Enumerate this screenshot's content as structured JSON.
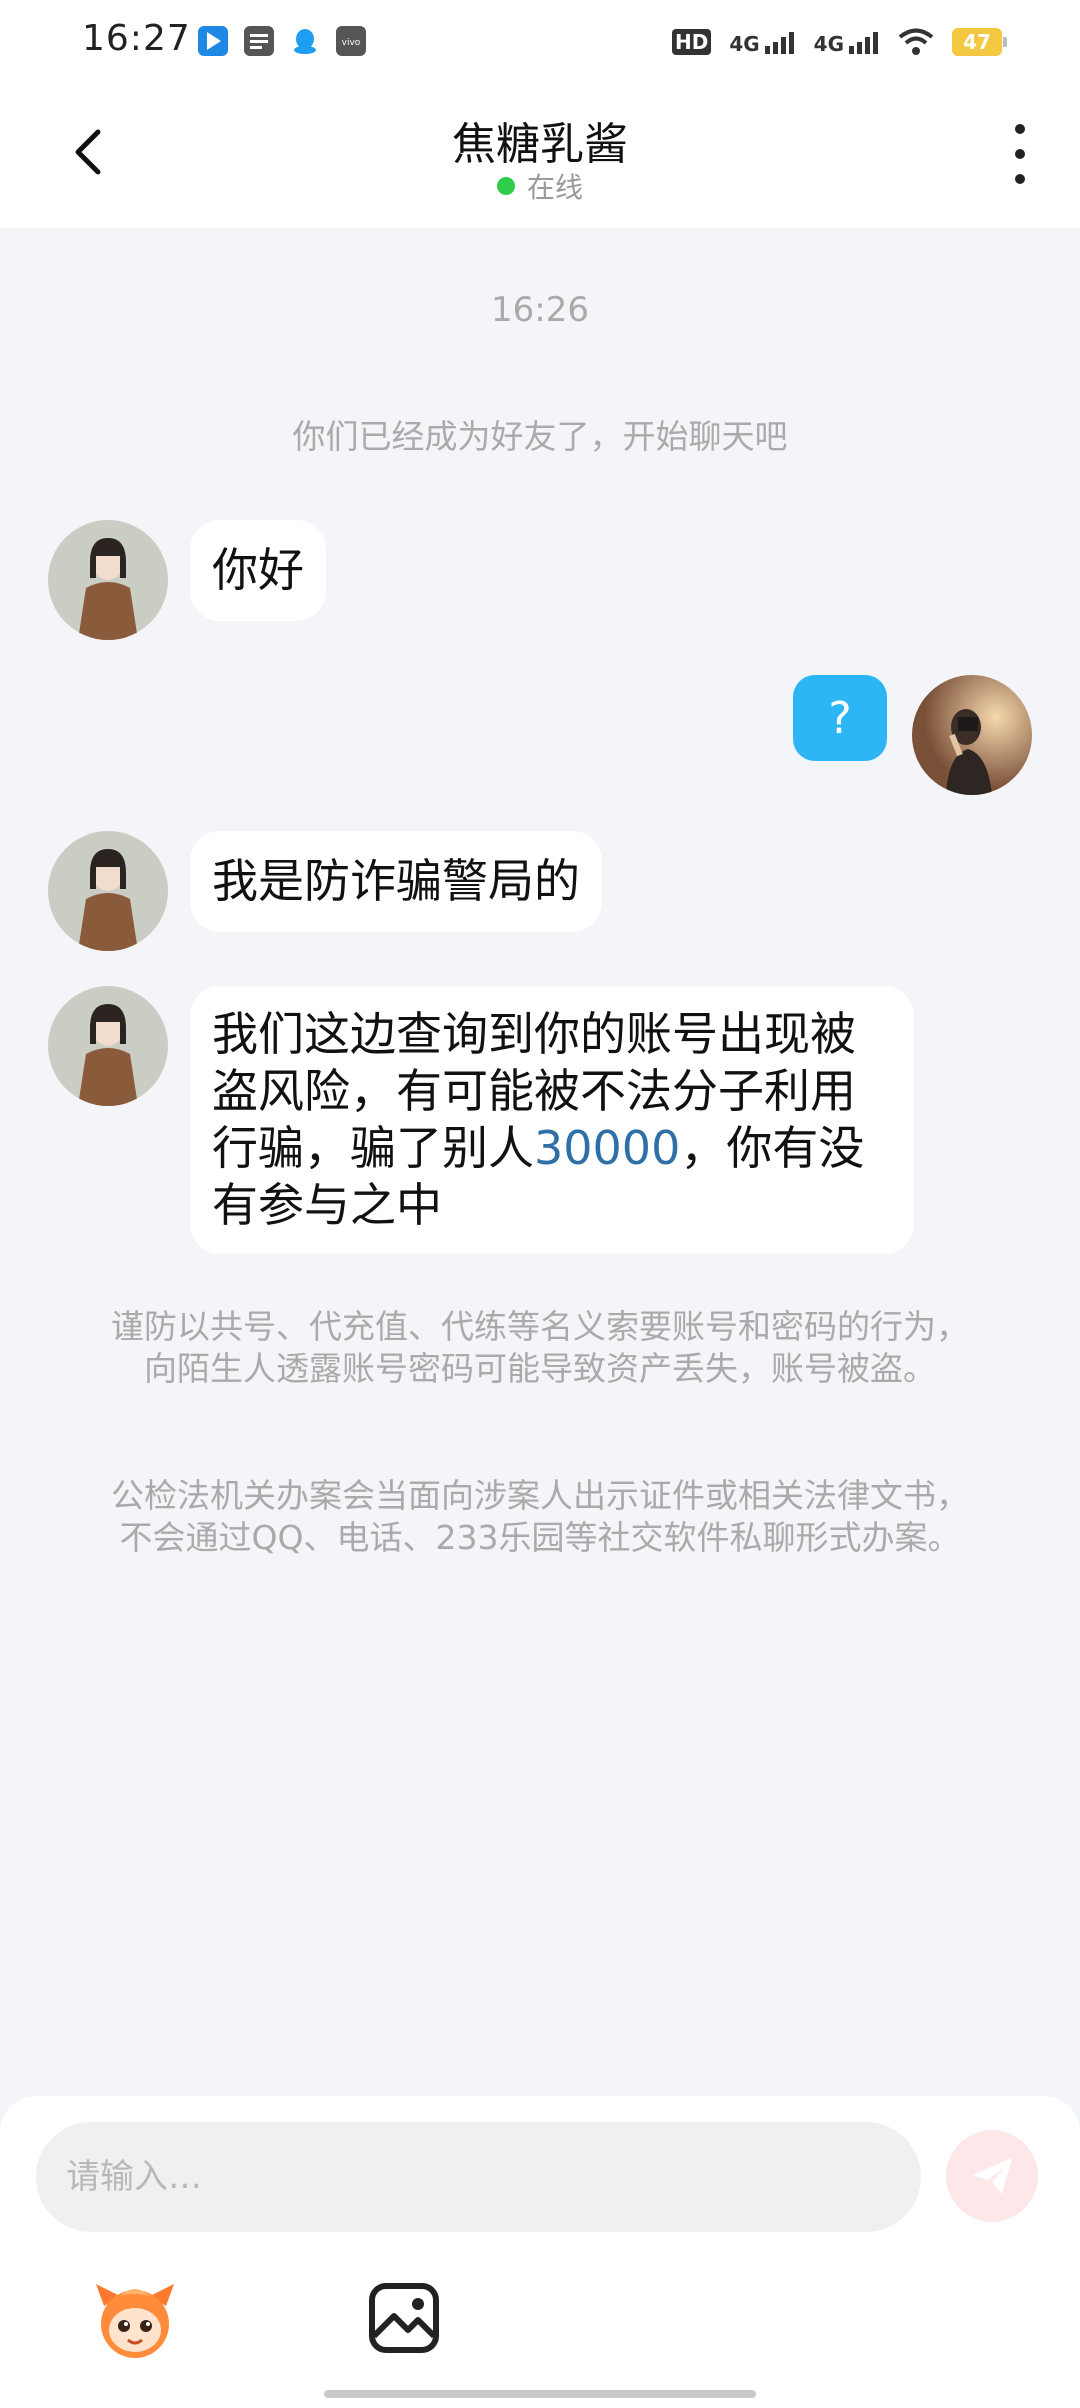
{
  "status_bar": {
    "time": "16:27",
    "hd_label": "HD",
    "sim1_network": "4G",
    "sim2_network": "4G",
    "battery_level": "47",
    "icons": [
      "app-blue-icon",
      "calendar-icon",
      "qq-icon",
      "vivo-icon",
      "signal-icon",
      "wifi-icon",
      "battery-icon"
    ]
  },
  "header": {
    "title": "焦糖乳酱",
    "status": "在线",
    "status_color": "#2ecc48"
  },
  "chat": {
    "time_separator": "16:26",
    "friend_notice": "你们已经成为好友了，开始聊天吧",
    "messages": [
      {
        "sender": "friend",
        "text": "你好"
      },
      {
        "sender": "me",
        "text": "?"
      },
      {
        "sender": "friend",
        "text": "我是防诈骗警局的"
      },
      {
        "sender": "friend",
        "text_lines": [
          "我们这边查询到你的账号出现被",
          "盗风险，有可能被不法分子利用",
          "行骗，骗了别人",
          "有参与之中"
        ],
        "amount": "30000",
        "after_amount": "，你有没"
      }
    ],
    "safety_notes": [
      "谨防以共号、代充值、代练等名义索要账号和密码的行为，向陌生人透露账号密码可能导致资产丢失，账号被盗。",
      "公检法机关办案会当面向涉案人出示证件或相关法律文书，不会通过QQ、电话、233乐园等社交软件私聊形式办案。"
    ]
  },
  "input_bar": {
    "placeholder": "请输入…",
    "send_icon": "paper-plane-icon",
    "emoji_icon": "mascot-emoji-icon",
    "image_icon": "image-icon"
  },
  "colors": {
    "my_bubble": "#2db6f5",
    "highlight": "#2f6fa8",
    "background": "#f3f5f8"
  }
}
